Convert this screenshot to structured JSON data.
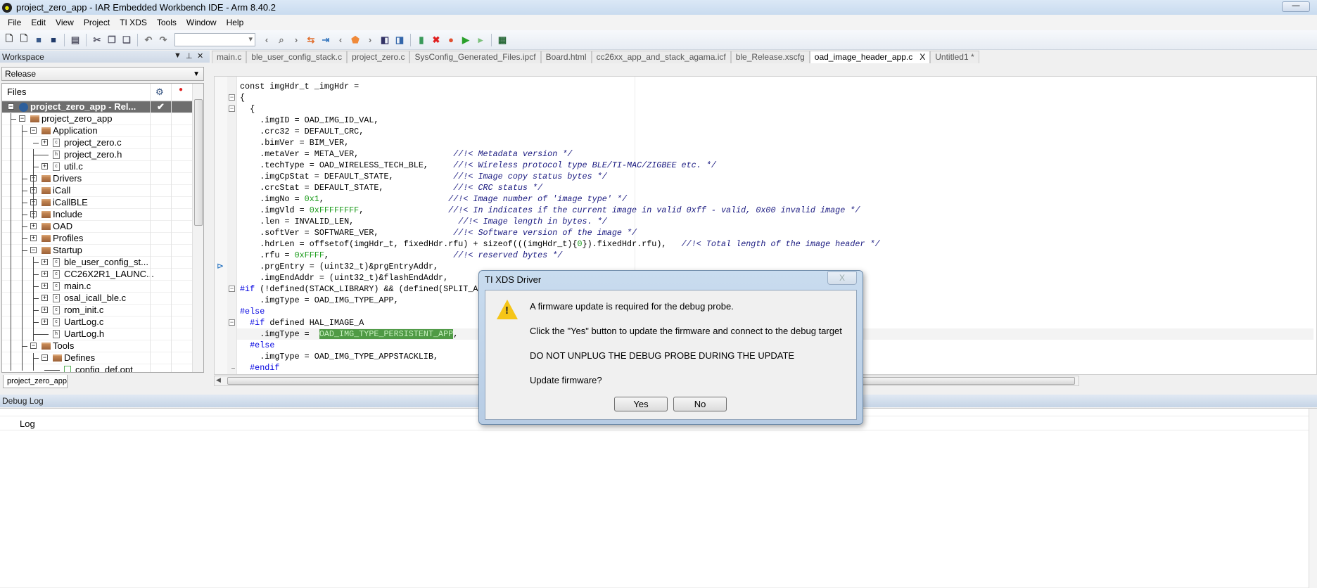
{
  "window": {
    "title": "project_zero_app - IAR Embedded Workbench IDE - Arm 8.40.2",
    "minimize": "—"
  },
  "menu": [
    "File",
    "Edit",
    "View",
    "Project",
    "TI XDS",
    "Tools",
    "Window",
    "Help"
  ],
  "toolbar": {
    "icons": [
      {
        "name": "new-file-icon",
        "glyph": "🗋",
        "color": "#333"
      },
      {
        "name": "open-file-icon",
        "glyph": "🗋",
        "color": "#333"
      },
      {
        "name": "save-icon",
        "glyph": "■",
        "color": "#3a5a8a"
      },
      {
        "name": "save-all-icon",
        "glyph": "■",
        "color": "#203a6a"
      },
      {
        "sep": true
      },
      {
        "name": "print-icon",
        "glyph": "▤",
        "color": "#556"
      },
      {
        "sep": true
      },
      {
        "name": "cut-icon",
        "glyph": "✂",
        "color": "#556"
      },
      {
        "name": "copy-icon",
        "glyph": "❐",
        "color": "#556"
      },
      {
        "name": "paste-icon",
        "glyph": "❏",
        "color": "#556"
      },
      {
        "sep": true
      },
      {
        "name": "undo-icon",
        "glyph": "↶",
        "color": "#777"
      },
      {
        "name": "redo-icon",
        "glyph": "↷",
        "color": "#777"
      },
      {
        "combo": true
      },
      {
        "name": "nav-back-icon",
        "glyph": "‹",
        "color": "#777"
      },
      {
        "name": "find-icon",
        "glyph": "⌕",
        "color": "#777"
      },
      {
        "name": "nav-forward-icon",
        "glyph": "›",
        "color": "#777"
      },
      {
        "name": "swap-icon",
        "glyph": "⇆",
        "color": "#e07030"
      },
      {
        "name": "indent-icon",
        "glyph": "⇥",
        "color": "#3a7ac0"
      },
      {
        "name": "prev-bookmark-icon",
        "glyph": "‹",
        "color": "#777"
      },
      {
        "name": "bookmark-icon",
        "glyph": "⬟",
        "color": "#f08a3a"
      },
      {
        "name": "next-bookmark-icon",
        "glyph": "›",
        "color": "#777"
      },
      {
        "name": "go-back-icon",
        "glyph": "◧",
        "color": "#336"
      },
      {
        "name": "go-forward-icon",
        "glyph": "◨",
        "color": "#36a"
      },
      {
        "sep": true
      },
      {
        "name": "compile-icon",
        "glyph": "▮",
        "color": "#3a9a5a"
      },
      {
        "name": "stop-build-icon",
        "glyph": "✖",
        "color": "#e02020"
      },
      {
        "name": "breakpoint-icon",
        "glyph": "●",
        "color": "#e05030"
      },
      {
        "name": "download-debug-icon",
        "glyph": "▶",
        "color": "#2aa02a"
      },
      {
        "name": "debug-without-download-icon",
        "glyph": "▸",
        "color": "#7ac07a"
      },
      {
        "sep": true
      },
      {
        "name": "layout-icon",
        "glyph": "▦",
        "color": "#2a6a3a"
      }
    ]
  },
  "workspace": {
    "title": "Workspace",
    "configuration": "Release",
    "files_label": "Files",
    "bottom_tab": "project_zero_app",
    "tree": [
      {
        "label": "project_zero_app - Rel...",
        "level": 0,
        "kind": "project",
        "exp": "-",
        "selected": true,
        "check": "✔"
      },
      {
        "label": "project_zero_app",
        "level": 1,
        "kind": "folder",
        "exp": "-"
      },
      {
        "label": "Application",
        "level": 2,
        "kind": "folder",
        "exp": "-"
      },
      {
        "label": "project_zero.c",
        "level": 3,
        "kind": "c",
        "exp": "+"
      },
      {
        "label": "project_zero.h",
        "level": 3,
        "kind": "h",
        "exp": ""
      },
      {
        "label": "util.c",
        "level": 3,
        "kind": "c",
        "exp": "+"
      },
      {
        "label": "Drivers",
        "level": 2,
        "kind": "folder",
        "exp": "+"
      },
      {
        "label": "iCall",
        "level": 2,
        "kind": "folder",
        "exp": "+"
      },
      {
        "label": "iCallBLE",
        "level": 2,
        "kind": "folder",
        "exp": "+"
      },
      {
        "label": "Include",
        "level": 2,
        "kind": "folder",
        "exp": "+"
      },
      {
        "label": "OAD",
        "level": 2,
        "kind": "folder",
        "exp": "+"
      },
      {
        "label": "Profiles",
        "level": 2,
        "kind": "folder",
        "exp": "+"
      },
      {
        "label": "Startup",
        "level": 2,
        "kind": "folder",
        "exp": "-"
      },
      {
        "label": "ble_user_config_st...",
        "level": 3,
        "kind": "c",
        "exp": "+"
      },
      {
        "label": "CC26X2R1_LAUNC...",
        "level": 3,
        "kind": "c",
        "exp": "+"
      },
      {
        "label": "main.c",
        "level": 3,
        "kind": "c",
        "exp": "+"
      },
      {
        "label": "osal_icall_ble.c",
        "level": 3,
        "kind": "c",
        "exp": "+"
      },
      {
        "label": "rom_init.c",
        "level": 3,
        "kind": "c",
        "exp": "+"
      },
      {
        "label": "UartLog.c",
        "level": 3,
        "kind": "c",
        "exp": "+"
      },
      {
        "label": "UartLog.h",
        "level": 3,
        "kind": "h",
        "exp": ""
      },
      {
        "label": "Tools",
        "level": 2,
        "kind": "folder",
        "exp": "-"
      },
      {
        "label": "Defines",
        "level": 3,
        "kind": "folder",
        "exp": "-"
      },
      {
        "label": "config_def.opt",
        "level": 4,
        "kind": "opt",
        "exp": ""
      }
    ]
  },
  "editor": {
    "tabs": [
      {
        "label": "main.c"
      },
      {
        "label": "ble_user_config_stack.c"
      },
      {
        "label": "project_zero.c"
      },
      {
        "label": "SysConfig_Generated_Files.ipcf"
      },
      {
        "label": "Board.html"
      },
      {
        "label": "cc26xx_app_and_stack_agama.icf"
      },
      {
        "label": "ble_Release.xscfg"
      },
      {
        "label": "oad_image_header_app.c",
        "active": true,
        "close": "X"
      },
      {
        "label": "Untitled1 *"
      }
    ],
    "lines": [
      {
        "s": [
          [
            "const imgHdr_t _imgHdr =",
            "plain"
          ]
        ]
      },
      {
        "fold": "open",
        "s": [
          [
            "{",
            "plain"
          ]
        ]
      },
      {
        "fold": "open",
        "s": [
          [
            "  {",
            "plain"
          ]
        ]
      },
      {
        "s": [
          [
            "    .imgID = OAD_IMG_ID_VAL,",
            "plain"
          ]
        ]
      },
      {
        "s": [
          [
            "    .crc32 = DEFAULT_CRC,",
            "plain"
          ]
        ]
      },
      {
        "s": [
          [
            "    .bimVer = BIM_VER,",
            "plain"
          ]
        ]
      },
      {
        "s": [
          [
            "    .metaVer = META_VER,                   ",
            "plain"
          ],
          [
            "//!< Metadata version */",
            "comment"
          ]
        ]
      },
      {
        "s": [
          [
            "    .techType = OAD_WIRELESS_TECH_BLE,     ",
            "plain"
          ],
          [
            "//!< Wireless protocol type BLE/TI-MAC/ZIGBEE etc. */",
            "comment"
          ]
        ]
      },
      {
        "s": [
          [
            "    .imgCpStat = DEFAULT_STATE,            ",
            "plain"
          ],
          [
            "//!< Image copy status bytes */",
            "comment"
          ]
        ]
      },
      {
        "s": [
          [
            "    .crcStat = DEFAULT_STATE,              ",
            "plain"
          ],
          [
            "//!< CRC status */",
            "comment"
          ]
        ]
      },
      {
        "s": [
          [
            "    .imgNo = ",
            "plain"
          ],
          [
            "0x1",
            "num"
          ],
          [
            ",                         ",
            "plain"
          ],
          [
            "//!< Image number of 'image type' */",
            "comment"
          ]
        ]
      },
      {
        "s": [
          [
            "    .imgVld = ",
            "plain"
          ],
          [
            "0xFFFFFFFF",
            "num"
          ],
          [
            ",                 ",
            "plain"
          ],
          [
            "//!< In indicates if the current image in valid 0xff - valid, 0x00 invalid image */",
            "comment"
          ]
        ]
      },
      {
        "s": [
          [
            "    .len = INVALID_LEN,                     ",
            "plain"
          ],
          [
            "//!< Image length in bytes. */",
            "comment"
          ]
        ]
      },
      {
        "s": [
          [
            "    .softVer = SOFTWARE_VER,               ",
            "plain"
          ],
          [
            "//!< Software version of the image */",
            "comment"
          ]
        ]
      },
      {
        "s": [
          [
            "    .hdrLen = offsetof(imgHdr_t, fixedHdr.rfu) + ",
            "plain"
          ],
          [
            "sizeof",
            "plain"
          ],
          [
            "(((imgHdr_t){",
            "plain"
          ],
          [
            "0",
            "num"
          ],
          [
            "}).fixedHdr.rfu),   ",
            "plain"
          ],
          [
            "//!< Total length of the image header */",
            "comment"
          ]
        ]
      },
      {
        "s": [
          [
            "    .rfu = ",
            "plain"
          ],
          [
            "0xFFFF",
            "num"
          ],
          [
            ",                         ",
            "plain"
          ],
          [
            "//!< reserved bytes */",
            "comment"
          ]
        ]
      },
      {
        "bookmark": true,
        "s": [
          [
            "    .prgEntry = (uint32_t)&prgEntryAddr,",
            "plain"
          ]
        ]
      },
      {
        "s": [
          [
            "    .imgEndAddr = (uint32_t)&flashEndAddr,",
            "plain"
          ]
        ]
      },
      {
        "fold": "open",
        "s": [
          [
            "#if",
            "dir"
          ],
          [
            " (!defined(STACK_LIBRARY) && (defined(SPLIT_AP",
            "plain"
          ]
        ]
      },
      {
        "s": [
          [
            "    .imgType = OAD_IMG_TYPE_APP,",
            "plain"
          ]
        ]
      },
      {
        "s": [
          [
            "#else",
            "dir"
          ]
        ]
      },
      {
        "fold": "open",
        "s": [
          [
            "  ",
            "plain"
          ],
          [
            "#if",
            "dir"
          ],
          [
            " defined HAL_IMAGE_A",
            "plain"
          ]
        ]
      },
      {
        "current": true,
        "s": [
          [
            "    .imgType =  ",
            "plain"
          ],
          [
            "OAD_IMG_TYPE_PERSISTENT_APP",
            "hl"
          ],
          [
            ",",
            "plain"
          ]
        ]
      },
      {
        "s": [
          [
            "  ",
            "plain"
          ],
          [
            "#else",
            "dir"
          ]
        ]
      },
      {
        "s": [
          [
            "    .imgType = OAD_IMG_TYPE_APPSTACKLIB,",
            "plain"
          ]
        ]
      },
      {
        "fold": "end",
        "s": [
          [
            "  ",
            "plain"
          ],
          [
            "#endif",
            "dir"
          ]
        ]
      }
    ]
  },
  "debug_log": {
    "title": "Debug Log",
    "column": "Log"
  },
  "dialog": {
    "title": "TI XDS Driver",
    "close": "X",
    "icon": "warning-icon",
    "messages": [
      "A firmware update is required for the debug probe.",
      "Click the \"Yes\" button to update the firmware and connect to the debug target",
      "DO NOT UNPLUG THE DEBUG PROBE DURING THE UPDATE",
      "Update firmware?"
    ],
    "yes": "Yes",
    "no": "No"
  }
}
